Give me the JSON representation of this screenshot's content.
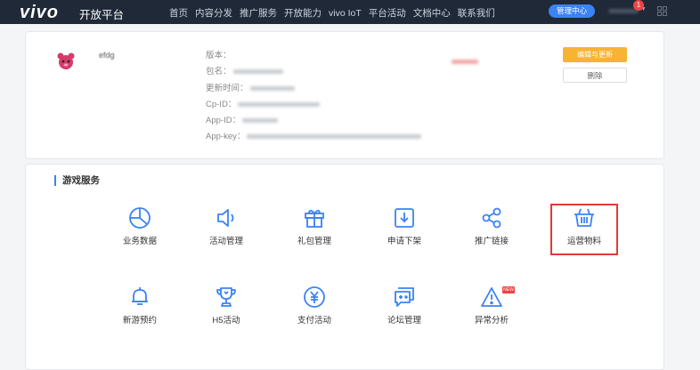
{
  "header": {
    "logo": "vivo",
    "platform": "开放平台",
    "nav": [
      "首页",
      "内容分发",
      "推广服务",
      "开放能力",
      "vivo IoT",
      "平台活动",
      "文档中心",
      "联系我们"
    ],
    "manage_button": "管理中心",
    "badge_count": "1",
    "colors": {
      "bar": "#1f2937",
      "manage_button": "#3b82f6",
      "badge": "#ef4444"
    }
  },
  "app_card": {
    "name": "efdg",
    "fields": [
      {
        "label": "版本："
      },
      {
        "label": "包名："
      },
      {
        "label": "更新时间："
      },
      {
        "label": "Cp-ID："
      },
      {
        "label": "App-ID："
      },
      {
        "label": "App-key："
      }
    ],
    "edit_button": "编辑与更新",
    "delete_button": "删除",
    "colors": {
      "edit_button": "#f7b335"
    }
  },
  "game_services": {
    "title": "游戏服务",
    "items": [
      {
        "label": "业务数据",
        "icon": "pie-chart-icon"
      },
      {
        "label": "活动管理",
        "icon": "megaphone-icon"
      },
      {
        "label": "礼包管理",
        "icon": "gift-icon"
      },
      {
        "label": "申请下架",
        "icon": "download-box-icon"
      },
      {
        "label": "推广链接",
        "icon": "share-icon"
      },
      {
        "label": "运营物料",
        "icon": "basket-icon",
        "highlighted": true
      },
      {
        "label": "新游预约",
        "icon": "bell-icon"
      },
      {
        "label": "H5活动",
        "icon": "trophy-icon"
      },
      {
        "label": "支付活动",
        "icon": "yuan-icon"
      },
      {
        "label": "论坛管理",
        "icon": "forum-icon"
      },
      {
        "label": "异常分析",
        "icon": "warning-icon",
        "new_tag": "NEW"
      }
    ],
    "colors": {
      "icon": "#3b82f6",
      "highlight": "#e53935"
    }
  }
}
